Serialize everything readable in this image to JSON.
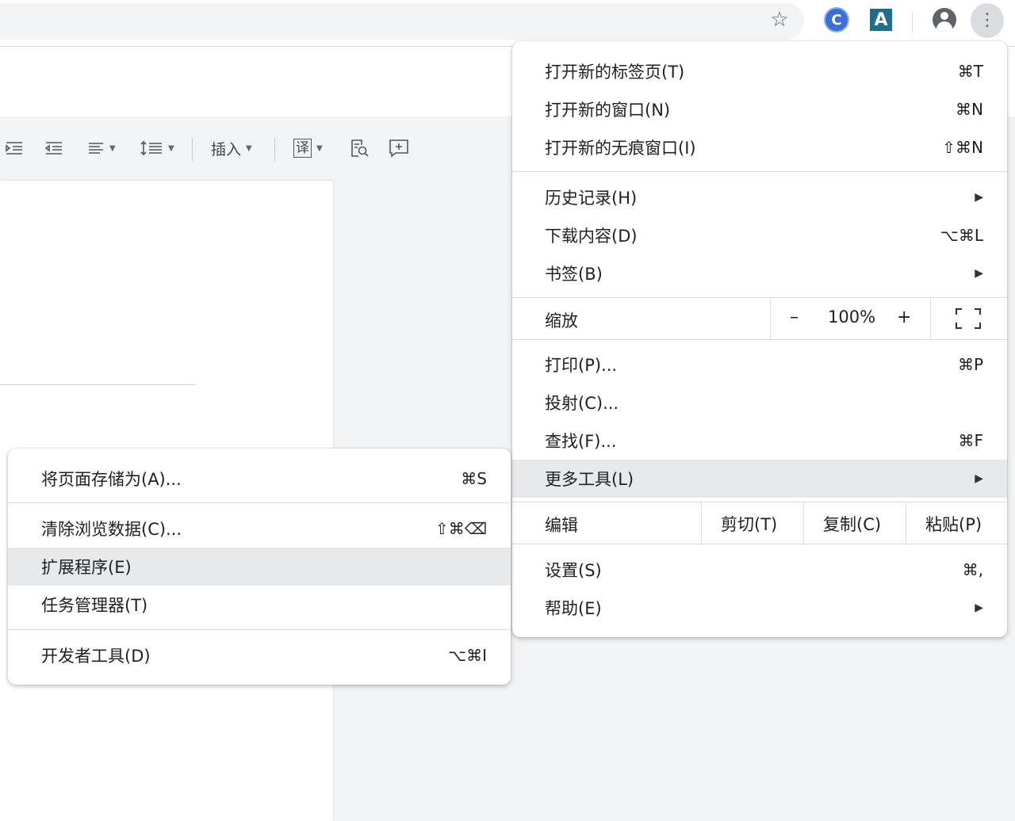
{
  "browser_toolbar": {
    "star_glyph": "☆",
    "ext1_glyph": "C",
    "ext2_glyph": "A",
    "kebab_glyph": "⋮"
  },
  "doc_toolbar": {
    "insert_label": "插入",
    "translate_glyph": "译"
  },
  "main_menu": {
    "new_tab": {
      "label": "打开新的标签页(T)",
      "shortcut": "⌘T"
    },
    "new_window": {
      "label": "打开新的窗口(N)",
      "shortcut": "⌘N"
    },
    "new_incognito": {
      "label": "打开新的无痕窗口(I)",
      "shortcut": "⇧⌘N"
    },
    "history": {
      "label": "历史记录(H)"
    },
    "downloads": {
      "label": "下载内容(D)",
      "shortcut": "⌥⌘L"
    },
    "bookmarks": {
      "label": "书签(B)"
    },
    "zoom": {
      "label": "缩放",
      "minus": "–",
      "value": "100%",
      "plus": "+"
    },
    "print": {
      "label": "打印(P)...",
      "shortcut": "⌘P"
    },
    "cast": {
      "label": "投射(C)..."
    },
    "find": {
      "label": "查找(F)...",
      "shortcut": "⌘F"
    },
    "more_tools": {
      "label": "更多工具(L)"
    },
    "edit": {
      "label": "编辑",
      "cut": "剪切(T)",
      "copy": "复制(C)",
      "paste": "粘贴(P)"
    },
    "settings": {
      "label": "设置(S)",
      "shortcut": "⌘,"
    },
    "help": {
      "label": "帮助(E)"
    },
    "arrow_glyph": "▶"
  },
  "sub_menu": {
    "save_page": {
      "label": "将页面存储为(A)...",
      "shortcut": "⌘S"
    },
    "clear_data": {
      "label": "清除浏览数据(C)...",
      "shortcut": "⇧⌘⌫"
    },
    "extensions": {
      "label": "扩展程序(E)"
    },
    "task_manager": {
      "label": "任务管理器(T)"
    },
    "dev_tools": {
      "label": "开发者工具(D)",
      "shortcut": "⌥⌘I"
    }
  }
}
